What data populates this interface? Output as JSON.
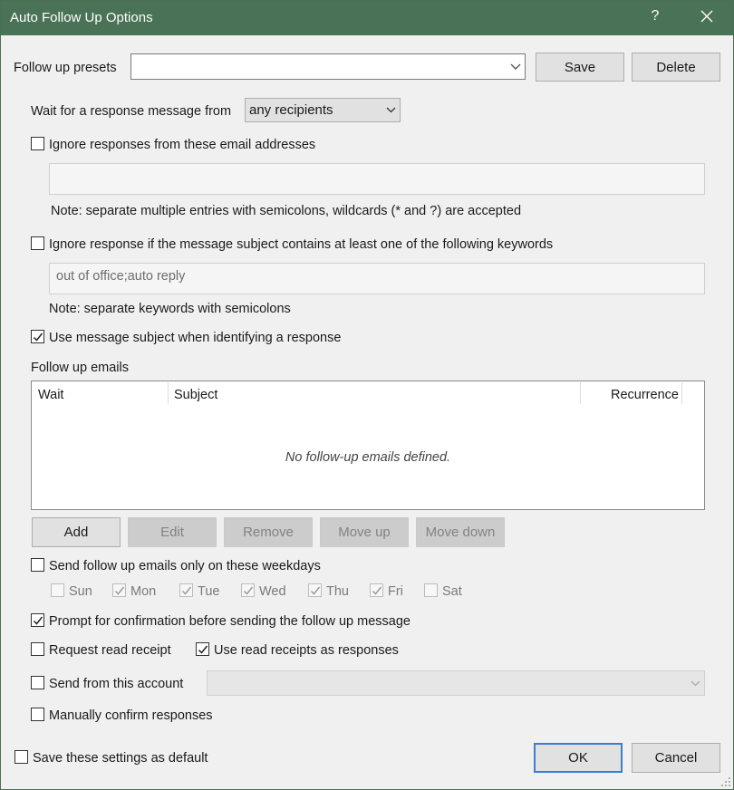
{
  "window": {
    "title": "Auto Follow Up Options",
    "help_label": "?",
    "close_label": "✕",
    "titlebar_color": "#4a7256"
  },
  "presets": {
    "label": "Follow up presets",
    "value": "",
    "save_label": "Save",
    "delete_label": "Delete"
  },
  "wait_response": {
    "label": "Wait for a response message from",
    "selected": "any recipients"
  },
  "ignore_emails": {
    "label": "Ignore responses from these email addresses",
    "checked": false,
    "value": "",
    "note": "Note: separate multiple entries with semicolons, wildcards (* and ?) are accepted"
  },
  "ignore_keywords": {
    "label": "Ignore response if the message subject contains at least one of the following keywords",
    "checked": false,
    "value": "out of office;auto reply",
    "note": "Note: separate keywords with semicolons"
  },
  "use_subject": {
    "label": "Use message subject when identifying a response",
    "checked": true
  },
  "follow_up_emails": {
    "label": "Follow up emails",
    "columns": [
      "Wait",
      "Subject",
      "Recurrence"
    ],
    "empty_text": "No follow-up emails defined.",
    "rows": []
  },
  "buttons": {
    "add": "Add",
    "edit": "Edit",
    "remove": "Remove",
    "move_up": "Move up",
    "move_down": "Move down"
  },
  "weekdays": {
    "label": "Send follow up emails only on these weekdays",
    "checked": false,
    "days": [
      {
        "name": "Sun",
        "checked": false
      },
      {
        "name": "Mon",
        "checked": true
      },
      {
        "name": "Tue",
        "checked": true
      },
      {
        "name": "Wed",
        "checked": true
      },
      {
        "name": "Thu",
        "checked": true
      },
      {
        "name": "Fri",
        "checked": true
      },
      {
        "name": "Sat",
        "checked": false
      }
    ]
  },
  "prompt_confirm": {
    "label": "Prompt for confirmation before sending the follow up message",
    "checked": true
  },
  "read_receipt": {
    "label": "Request read receipt",
    "checked": false
  },
  "use_read_receipts": {
    "label": "Use read receipts as responses",
    "checked": true
  },
  "send_from": {
    "label": "Send from this account",
    "checked": false,
    "value": ""
  },
  "manual_confirm": {
    "label": "Manually confirm responses",
    "checked": false
  },
  "save_default": {
    "label": "Save these settings as default",
    "checked": false
  },
  "footer": {
    "ok_label": "OK",
    "cancel_label": "Cancel"
  }
}
